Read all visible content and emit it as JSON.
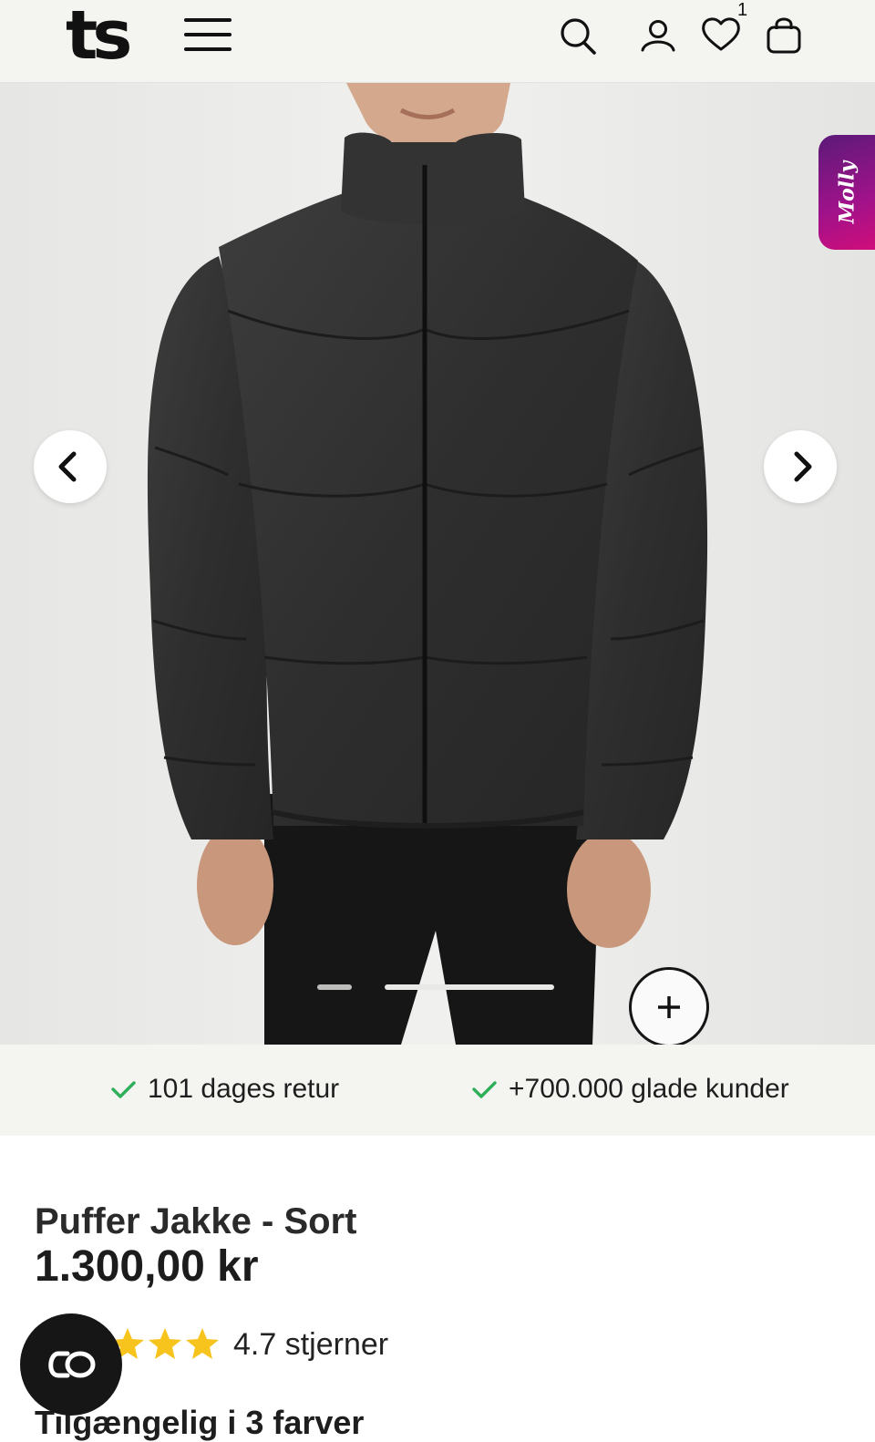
{
  "header": {
    "logo": "ts",
    "wishlist_count": "1"
  },
  "hero": {
    "brand_badge": "Molly",
    "icons": [
      "chevron-left-icon",
      "chevron-right-icon",
      "plus-icon"
    ],
    "carousel_total": 2,
    "carousel_active_index": 1
  },
  "usp": {
    "returns": "101 dages retur",
    "customers": "+700.000 glade kunder"
  },
  "product": {
    "title": "Puffer Jakke - Sort",
    "price": "1.300,00 kr",
    "rating_text": "4.7 stjerner",
    "rating_value": 4.7,
    "colors_text": "Tilgængelig i 3 farver"
  },
  "colors": {
    "accent_green": "#2fae5a",
    "star_yellow": "#f7c31d",
    "badge_magenta": "#a0128a"
  }
}
